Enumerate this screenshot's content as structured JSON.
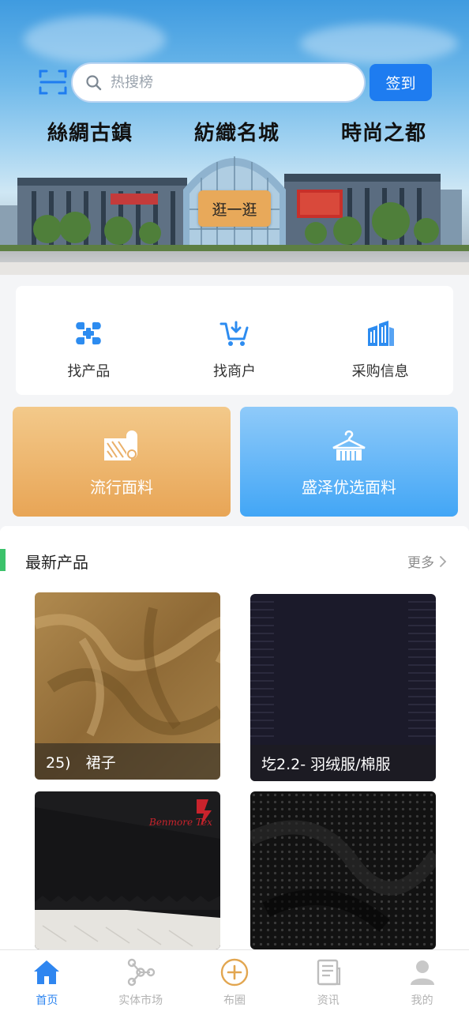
{
  "header": {
    "search_placeholder": "热搜榜",
    "signin_label": "签到",
    "slogan": [
      "絲綢古鎮",
      "紡織名城",
      "時尚之都"
    ],
    "stroll_label": "逛一逛"
  },
  "quick_nav": {
    "items": [
      {
        "label": "找产品",
        "icon": "product-icon"
      },
      {
        "label": "找商户",
        "icon": "cart-icon"
      },
      {
        "label": "采购信息",
        "icon": "buildings-icon"
      }
    ]
  },
  "features": {
    "left": {
      "label": "流行面料",
      "icon": "fabric-roll-icon"
    },
    "right": {
      "label": "盛泽优选面料",
      "icon": "hanger-icon"
    }
  },
  "latest": {
    "title": "最新产品",
    "more_label": "更多",
    "products": [
      {
        "caption": "25)　裙子"
      },
      {
        "caption": "圪2.2- 羽绒服/棉服"
      },
      {
        "caption": ""
      },
      {
        "caption": ""
      }
    ],
    "product3_logo_text": "Benmore Tex"
  },
  "tabbar": {
    "tabs": [
      {
        "label": "首页",
        "icon": "home-icon",
        "active": true
      },
      {
        "label": "实体市场",
        "icon": "network-icon",
        "active": false
      },
      {
        "label": "布圈",
        "icon": "plus-circle-icon",
        "active": false
      },
      {
        "label": "资讯",
        "icon": "news-icon",
        "active": false
      },
      {
        "label": "我的",
        "icon": "user-icon",
        "active": false
      }
    ]
  },
  "colors": {
    "primary": "#1e7cf0",
    "accent_green": "#3cc26b",
    "stroll_orange": "#e8a95a",
    "tab_active": "#2f86f0"
  }
}
